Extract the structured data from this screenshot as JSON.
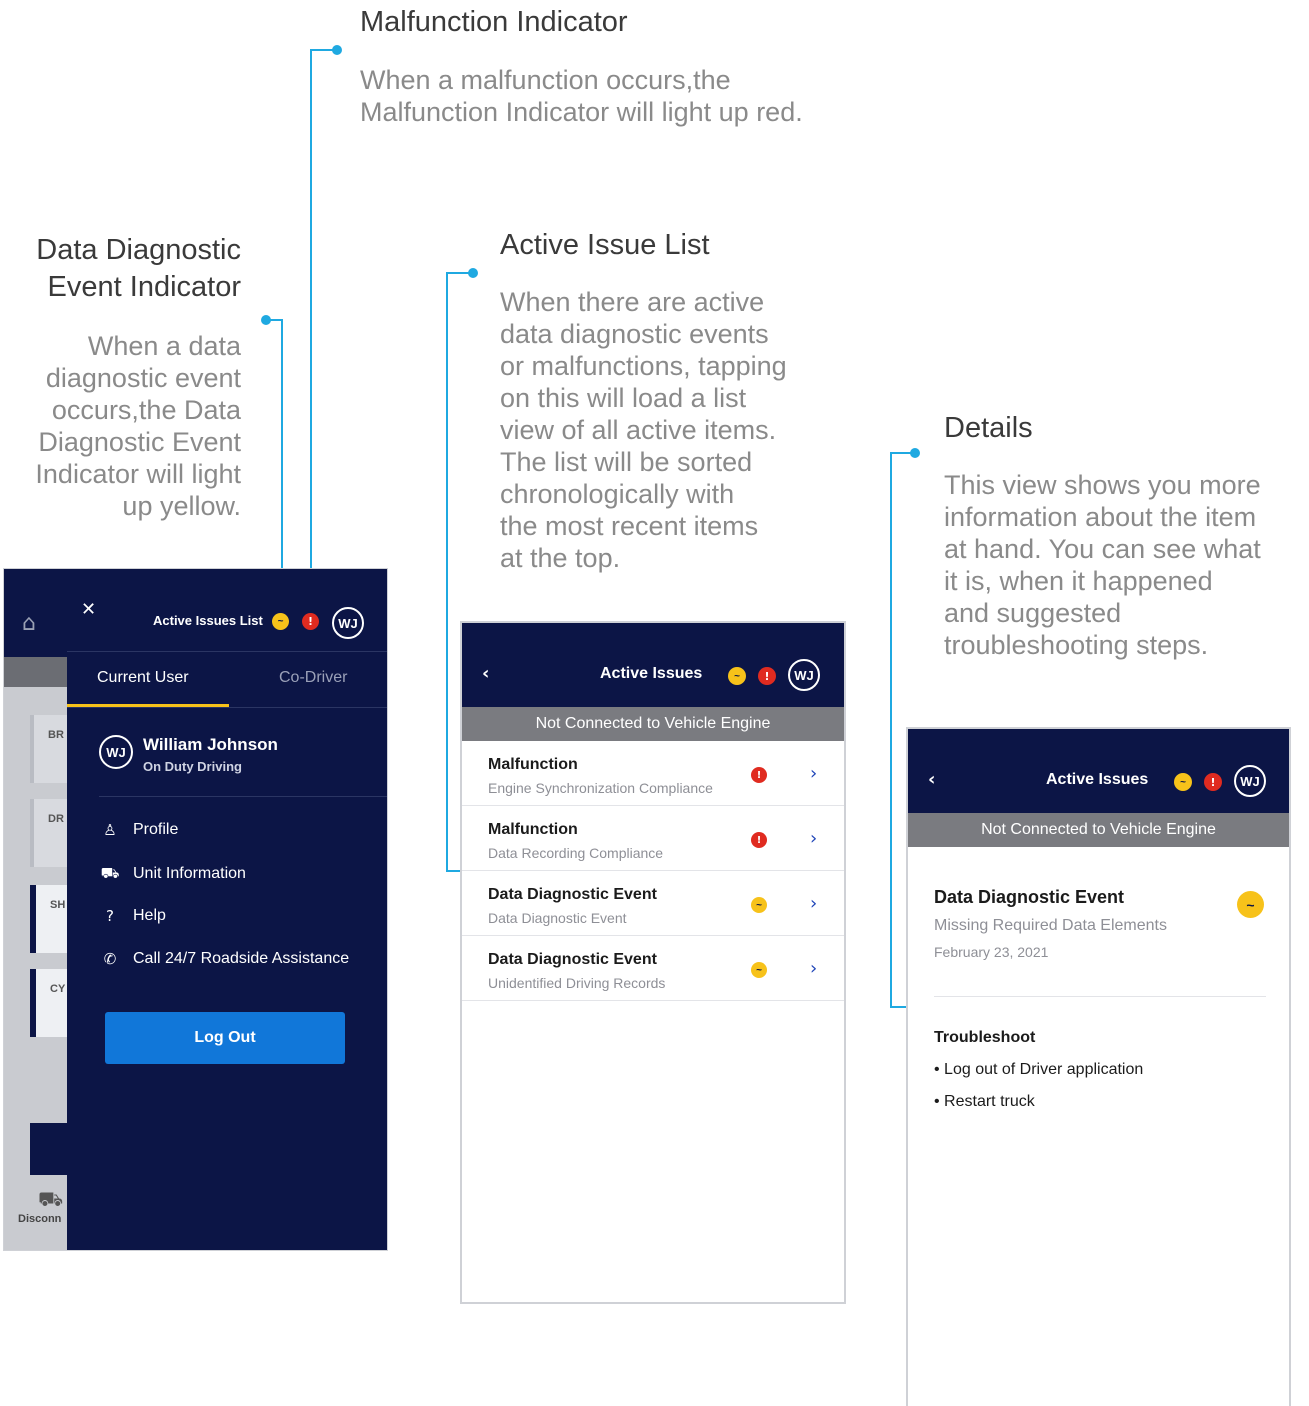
{
  "annotations": {
    "malfunction": {
      "title": "Malfunction Indicator",
      "body_line1": "When a malfunction occurs,the",
      "body_line2": "Malfunction Indicator will light up red."
    },
    "dde": {
      "title_line1": "Data Diagnostic",
      "title_line2": "Event Indicator",
      "body_lines": [
        "When a data",
        "diagnostic event",
        "occurs,the Data",
        "Diagnostic Event",
        "Indicator will light",
        "up yellow."
      ]
    },
    "active_list": {
      "title": "Active Issue List",
      "body_lines": [
        "When there are active",
        "data diagnostic events",
        "or malfunctions, tapping",
        "on this will load a list",
        "view of all active items.",
        "The list will be sorted",
        "chronologically with",
        "the most recent items",
        "at the top."
      ]
    },
    "details": {
      "title": "Details",
      "body_lines": [
        "This view shows you more",
        "information about the item",
        "at hand. You can see what",
        "it is, when it happened",
        "and suggested",
        "troubleshooting steps."
      ]
    }
  },
  "colors": {
    "navy": "#0c1546",
    "accent_blue": "#1fa9e1",
    "dde_yellow": "#f7c21a",
    "malfunction_red": "#e02b20",
    "logout_blue": "#1177d9"
  },
  "phone1": {
    "background_labels": [
      "BR",
      "DR",
      "SH",
      "CY"
    ],
    "disconnect_label": "Disconn",
    "drawer": {
      "close_glyph": "✕",
      "header_title": "Active Issues List",
      "avatar": "WJ",
      "tabs": [
        "Current User",
        "Co-Driver"
      ],
      "user_name": "William Johnson",
      "user_status": "On Duty Driving",
      "menu": [
        {
          "label": "Profile",
          "icon": "person-icon"
        },
        {
          "label": "Unit Information",
          "icon": "truck-icon"
        },
        {
          "label": "Help",
          "icon": "help-icon"
        },
        {
          "label": "Call 24/7 Roadside Assistance",
          "icon": "phone-icon"
        }
      ],
      "logout_label": "Log Out"
    }
  },
  "phone2": {
    "header_title": "Active Issues",
    "avatar": "WJ",
    "banner": "Not Connected to Vehicle Engine",
    "rows": [
      {
        "title": "Malfunction",
        "subtitle": "Engine Synchronization Compliance",
        "type": "malfunction"
      },
      {
        "title": "Malfunction",
        "subtitle": "Data Recording Compliance",
        "type": "malfunction"
      },
      {
        "title": "Data Diagnostic Event",
        "subtitle": "Data Diagnostic Event",
        "type": "dde"
      },
      {
        "title": "Data Diagnostic Event",
        "subtitle": "Unidentified Driving Records",
        "type": "dde"
      }
    ]
  },
  "phone3": {
    "header_title": "Active Issues",
    "avatar": "WJ",
    "banner": "Not Connected to Vehicle Engine",
    "detail_title": "Data Diagnostic Event",
    "detail_subtitle": "Missing Required Data Elements",
    "detail_date": "February 23, 2021",
    "troubleshoot_title": "Troubleshoot",
    "steps": [
      "• Log out of Driver application",
      "• Restart truck"
    ]
  }
}
